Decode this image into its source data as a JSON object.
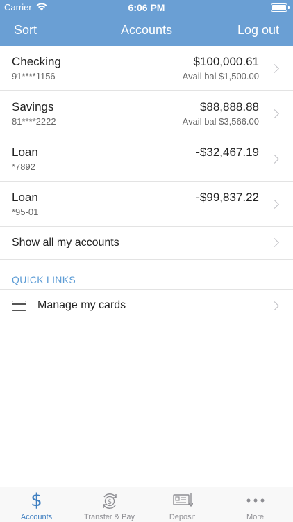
{
  "status_bar": {
    "carrier": "Carrier",
    "time": "6:06 PM"
  },
  "nav": {
    "left": "Sort",
    "title": "Accounts",
    "right": "Log out"
  },
  "accounts": [
    {
      "name": "Checking",
      "number": "91****1156",
      "balance": "$100,000.61",
      "available": "Avail bal $1,500.00"
    },
    {
      "name": "Savings",
      "number": "81****2222",
      "balance": "$88,888.88",
      "available": "Avail bal $3,566.00"
    },
    {
      "name": "Loan",
      "number": "*7892",
      "balance": "-$32,467.19",
      "available": ""
    },
    {
      "name": "Loan",
      "number": "*95-01",
      "balance": "-$99,837.22",
      "available": ""
    }
  ],
  "show_all": "Show all my accounts",
  "quick_links": {
    "title": "QUICK LINKS",
    "items": [
      {
        "label": "Manage my cards",
        "icon": "credit-card-icon"
      }
    ]
  },
  "tabs": [
    {
      "label": "Accounts",
      "icon": "dollar-icon",
      "active": true
    },
    {
      "label": "Transfer & Pay",
      "icon": "transfer-icon",
      "active": false
    },
    {
      "label": "Deposit",
      "icon": "deposit-check-icon",
      "active": false
    },
    {
      "label": "More",
      "icon": "more-dots-icon",
      "active": false
    }
  ],
  "colors": {
    "header": "#6a9fd4",
    "accent": "#3f7fc1",
    "quick_links_title": "#5b9bd5"
  }
}
